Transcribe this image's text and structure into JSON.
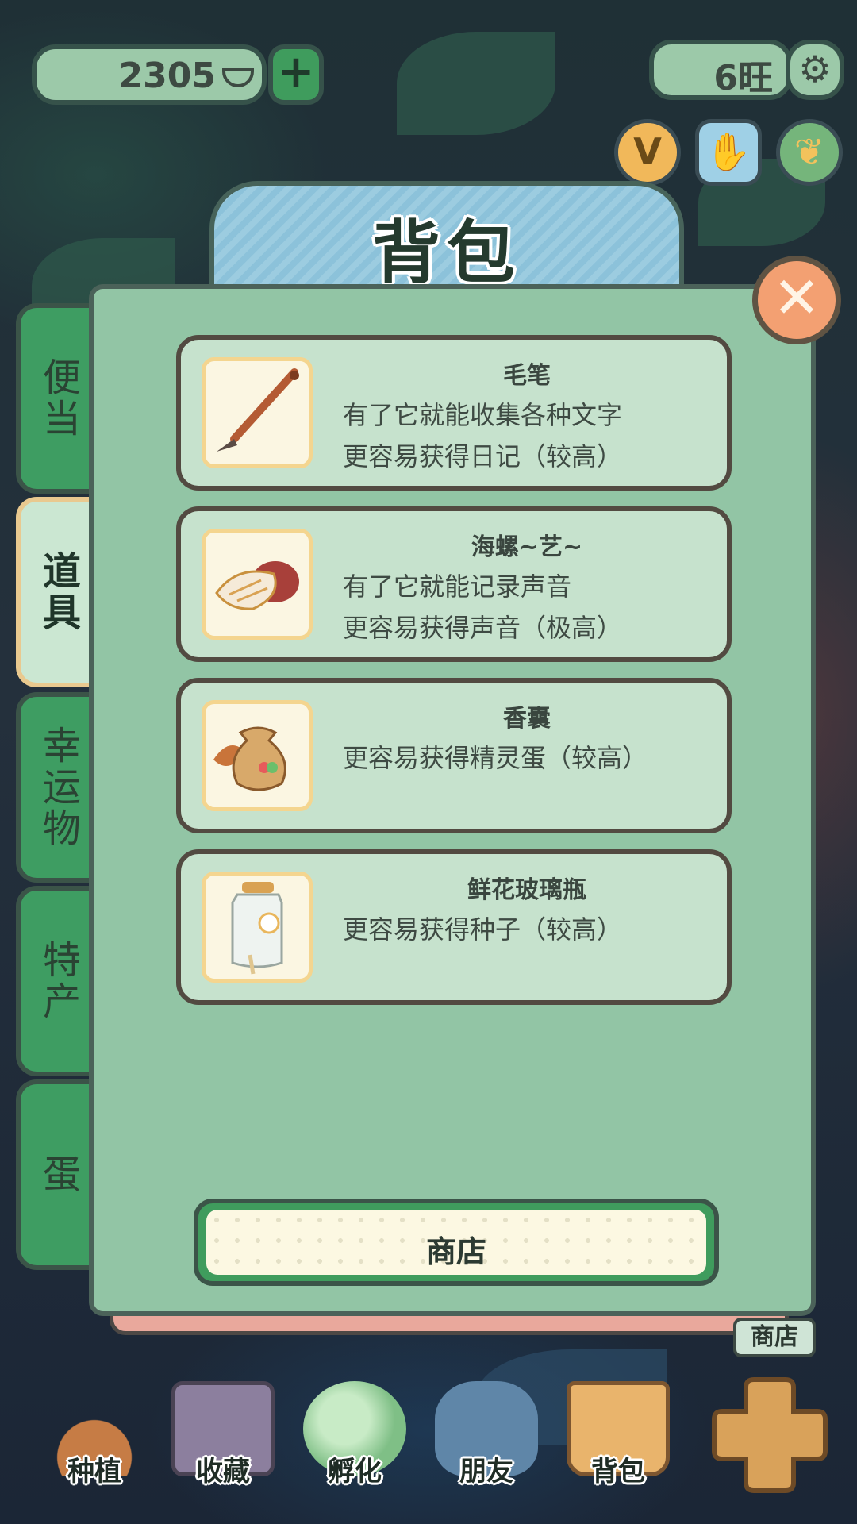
{
  "top_bar": {
    "currency_value": "2305",
    "wang_value": "6旺"
  },
  "panel": {
    "title": "背包",
    "tabs": [
      {
        "label": "便当"
      },
      {
        "label": "道具"
      },
      {
        "label": "幸运物"
      },
      {
        "label": "特产"
      },
      {
        "label": "蛋"
      }
    ],
    "active_tab": "道具",
    "items": [
      {
        "name": "毛笔",
        "desc1": "有了它就能收集各种文字",
        "desc2": "更容易获得日记（较高）",
        "icon": "brush-icon"
      },
      {
        "name": "海螺~艺~",
        "desc1": "有了它就能记录声音",
        "desc2": "更容易获得声音（极高）",
        "icon": "conch-icon"
      },
      {
        "name": "香囊",
        "desc1": "更容易获得精灵蛋（较高）",
        "icon": "sachet-icon"
      },
      {
        "name": "鲜花玻璃瓶",
        "desc1": "更容易获得种子（较高）",
        "icon": "flower-jar-icon"
      }
    ],
    "shop_button": "商店"
  },
  "bottom_nav": {
    "mini_shop": "商店",
    "items": [
      {
        "label": "种植"
      },
      {
        "label": "收藏"
      },
      {
        "label": "孵化"
      },
      {
        "label": "朋友"
      },
      {
        "label": "背包"
      }
    ]
  },
  "colors": {
    "panel_bg": "#92c5a5",
    "tab_green": "#3e9d62",
    "title_blue": "#9ccce0",
    "close_orange": "#f3a072"
  }
}
